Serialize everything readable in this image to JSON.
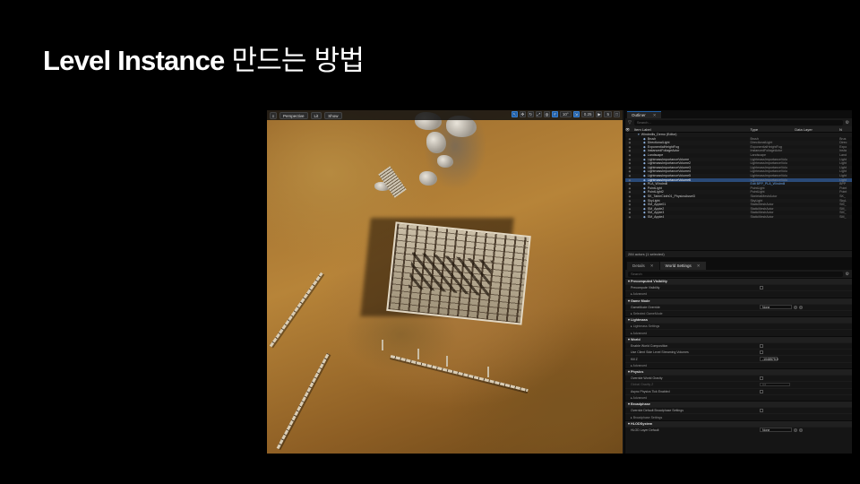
{
  "slide": {
    "title_en": "Level Instance",
    "title_ko": "만드는 방법"
  },
  "viewport": {
    "mode_label": "Perspective",
    "lit_label": "Lit",
    "show_label": "Show",
    "grid_value": "10°",
    "scale_value": "0.25",
    "cam_value": "5"
  },
  "outliner": {
    "tab_label": "Outliner",
    "search_placeholder": "Search...",
    "col_label": "Item Label",
    "col_type": "Type",
    "col_layer": "Data Layer",
    "rows": [
      {
        "label": "Windmills_Demo (Editor)",
        "type": "",
        "ext": "",
        "selected": false,
        "link": false
      },
      {
        "label": "Brush",
        "type": "Brush",
        "ext": "Brus",
        "selected": false,
        "link": false
      },
      {
        "label": "DirectionalLight",
        "type": "DirectionalLight",
        "ext": "Direc",
        "selected": false,
        "link": false
      },
      {
        "label": "ExponentialHeightFog",
        "type": "ExponentialHeightFog",
        "ext": "Expo",
        "selected": false,
        "link": false
      },
      {
        "label": "InstancedFoliageActor",
        "type": "InstancedFoliageActor",
        "ext": "Insta",
        "selected": false,
        "link": false
      },
      {
        "label": "Landscape",
        "type": "Landscape",
        "ext": "Land",
        "selected": false,
        "link": false
      },
      {
        "label": "LightmassImportanceVolume",
        "type": "LightmassImportanceVolu",
        "ext": "Light",
        "selected": false,
        "link": false
      },
      {
        "label": "LightmassImportanceVolume2",
        "type": "LightmassImportanceVolu",
        "ext": "Light",
        "selected": false,
        "link": false
      },
      {
        "label": "LightmassImportanceVolume3",
        "type": "LightmassImportanceVolu",
        "ext": "Light",
        "selected": false,
        "link": false
      },
      {
        "label": "LightmassImportanceVolume4",
        "type": "LightmassImportanceVolu",
        "ext": "Light",
        "selected": false,
        "link": false
      },
      {
        "label": "LightmassImportanceVolume5",
        "type": "LightmassImportanceVolu",
        "ext": "Light",
        "selected": false,
        "link": false
      },
      {
        "label": "LightmassImportanceVolume6",
        "type": "LightmassImportanceVolu",
        "ext": "Light",
        "selected": true,
        "link": false
      },
      {
        "label": "PLA_Windmill",
        "type": "Edit BPP_PLA_Windmill",
        "ext": "BPP",
        "selected": false,
        "link": true
      },
      {
        "label": "PointLight",
        "type": "PointLight",
        "ext": "Point",
        "selected": false,
        "link": false
      },
      {
        "label": "PointLight2",
        "type": "PointLight",
        "ext": "Point",
        "selected": false,
        "link": false
      },
      {
        "label": "SK_TableCloth01_PhysicsAsset3",
        "type": "SkeletalMeshActor",
        "ext": "SK_",
        "selected": false,
        "link": false
      },
      {
        "label": "SkyLight",
        "type": "SkyLight",
        "ext": "SkyL",
        "selected": false,
        "link": false
      },
      {
        "label": "SM_Apple01",
        "type": "StaticMeshActor",
        "ext": "SM_",
        "selected": false,
        "link": false
      },
      {
        "label": "SM_Apple2",
        "type": "StaticMeshActor",
        "ext": "SM_",
        "selected": false,
        "link": false
      },
      {
        "label": "SM_Apple3",
        "type": "StaticMeshActor",
        "ext": "SM_",
        "selected": false,
        "link": false
      },
      {
        "label": "SM_Apple4",
        "type": "StaticMeshActor",
        "ext": "SM_",
        "selected": false,
        "link": false
      }
    ],
    "count_label": "284 actors (1 selected)"
  },
  "details": {
    "tab_details": "Details",
    "tab_world": "World Settings",
    "search_placeholder": "Search",
    "sections": [
      {
        "kind": "cat",
        "label": "Precomputed Visibility"
      },
      {
        "kind": "prop",
        "label": "Precompute Visibility",
        "control": "check"
      },
      {
        "kind": "sub",
        "label": "Advanced"
      },
      {
        "kind": "cat",
        "label": "Game Mode"
      },
      {
        "kind": "prop",
        "label": "GameMode Override",
        "control": "dropdown",
        "value": "None"
      },
      {
        "kind": "sub",
        "label": "Selected GameMode"
      },
      {
        "kind": "cat",
        "label": "Lightmass"
      },
      {
        "kind": "sub",
        "label": "Lightmass Settings"
      },
      {
        "kind": "sub",
        "label": "Advanced"
      },
      {
        "kind": "cat",
        "label": "World"
      },
      {
        "kind": "prop",
        "label": "Enable World Composition",
        "control": "check"
      },
      {
        "kind": "prop",
        "label": "Use Client Side Level Streaming Volumes",
        "control": "check"
      },
      {
        "kind": "prop",
        "label": "Kill Z",
        "control": "number",
        "value": "-1048575.0"
      },
      {
        "kind": "sub",
        "label": "Advanced"
      },
      {
        "kind": "cat",
        "label": "Physics"
      },
      {
        "kind": "prop",
        "label": "Override World Gravity",
        "control": "check"
      },
      {
        "kind": "prop",
        "label": "Global Gravity Z",
        "control": "slider",
        "value": "0.0",
        "dim": true
      },
      {
        "kind": "prop",
        "label": "Async Physics Tick Enabled",
        "control": "check"
      },
      {
        "kind": "sub",
        "label": "Advanced"
      },
      {
        "kind": "cat",
        "label": "Broadphase"
      },
      {
        "kind": "prop",
        "label": "Override Default Broadphase Settings",
        "control": "check"
      },
      {
        "kind": "sub",
        "label": "Broadphase Settings"
      },
      {
        "kind": "cat",
        "label": "HLODSystem"
      },
      {
        "kind": "prop",
        "label": "HLOD Layer Default",
        "control": "dropdown",
        "value": "None"
      }
    ]
  }
}
